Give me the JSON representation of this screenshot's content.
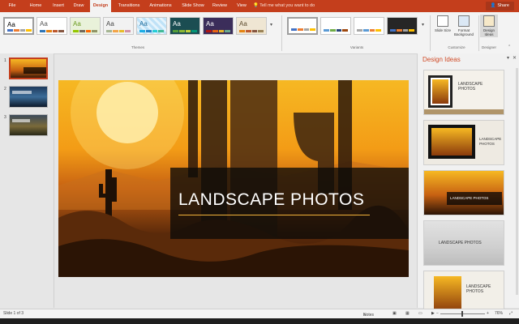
{
  "tabs": [
    "File",
    "Home",
    "Insert",
    "Draw",
    "Design",
    "Transitions",
    "Animations",
    "Slide Show",
    "Review",
    "View"
  ],
  "active_tab": "Design",
  "tell_me": "Tell me what you want to do",
  "share": "Share",
  "ribbon": {
    "themes_label": "Themes",
    "variants_label": "Variants",
    "customize_label": "Customize",
    "designer_label": "Designer",
    "theme_sample": "Aa",
    "slide_size": "Slide Size",
    "format_background": "Format Background",
    "design_ideas": "Design Ideas"
  },
  "slides": [
    "1",
    "2",
    "3"
  ],
  "slide_title": "LANDSCAPE PHOTOS",
  "ideas_pane": {
    "title": "Design Ideas",
    "idea_text": "LANDSCAPE PHOTOS"
  },
  "status": {
    "slide_count": "Slide 1 of 3",
    "notes": "Notes",
    "zoom": "76%"
  },
  "colors": {
    "accent": "#c43e1c",
    "ideas_title": "#d04a26"
  }
}
